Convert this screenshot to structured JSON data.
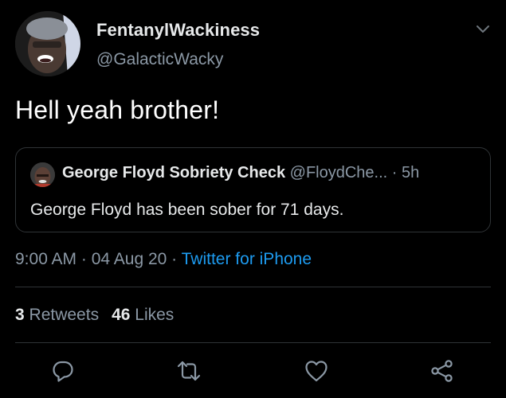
{
  "user": {
    "display_name": "FentanylWackiness",
    "handle": "@GalacticWacky"
  },
  "tweet": {
    "text": "Hell yeah brother!"
  },
  "quoted_tweet": {
    "display_name": "George Floyd Sobriety Check",
    "handle": "@FloydChe...",
    "separator": " · ",
    "age": "5h",
    "text": "George Floyd has been sober for 71 days."
  },
  "meta": {
    "time": "9:00 AM",
    "sep1": " · ",
    "date": "04 Aug 20",
    "sep2": " · ",
    "source": "Twitter for iPhone"
  },
  "stats": {
    "retweets_count": "3",
    "retweets_label": "Retweets",
    "likes_count": "46",
    "likes_label": "Likes"
  },
  "actions": {
    "reply_icon": "reply-icon",
    "retweet_icon": "retweet-icon",
    "like_icon": "heart-icon",
    "share_icon": "share-icon"
  },
  "colors": {
    "background": "#000000",
    "link": "#1d9bf0",
    "secondary_text": "#8b98a5",
    "border": "#2f3336"
  }
}
